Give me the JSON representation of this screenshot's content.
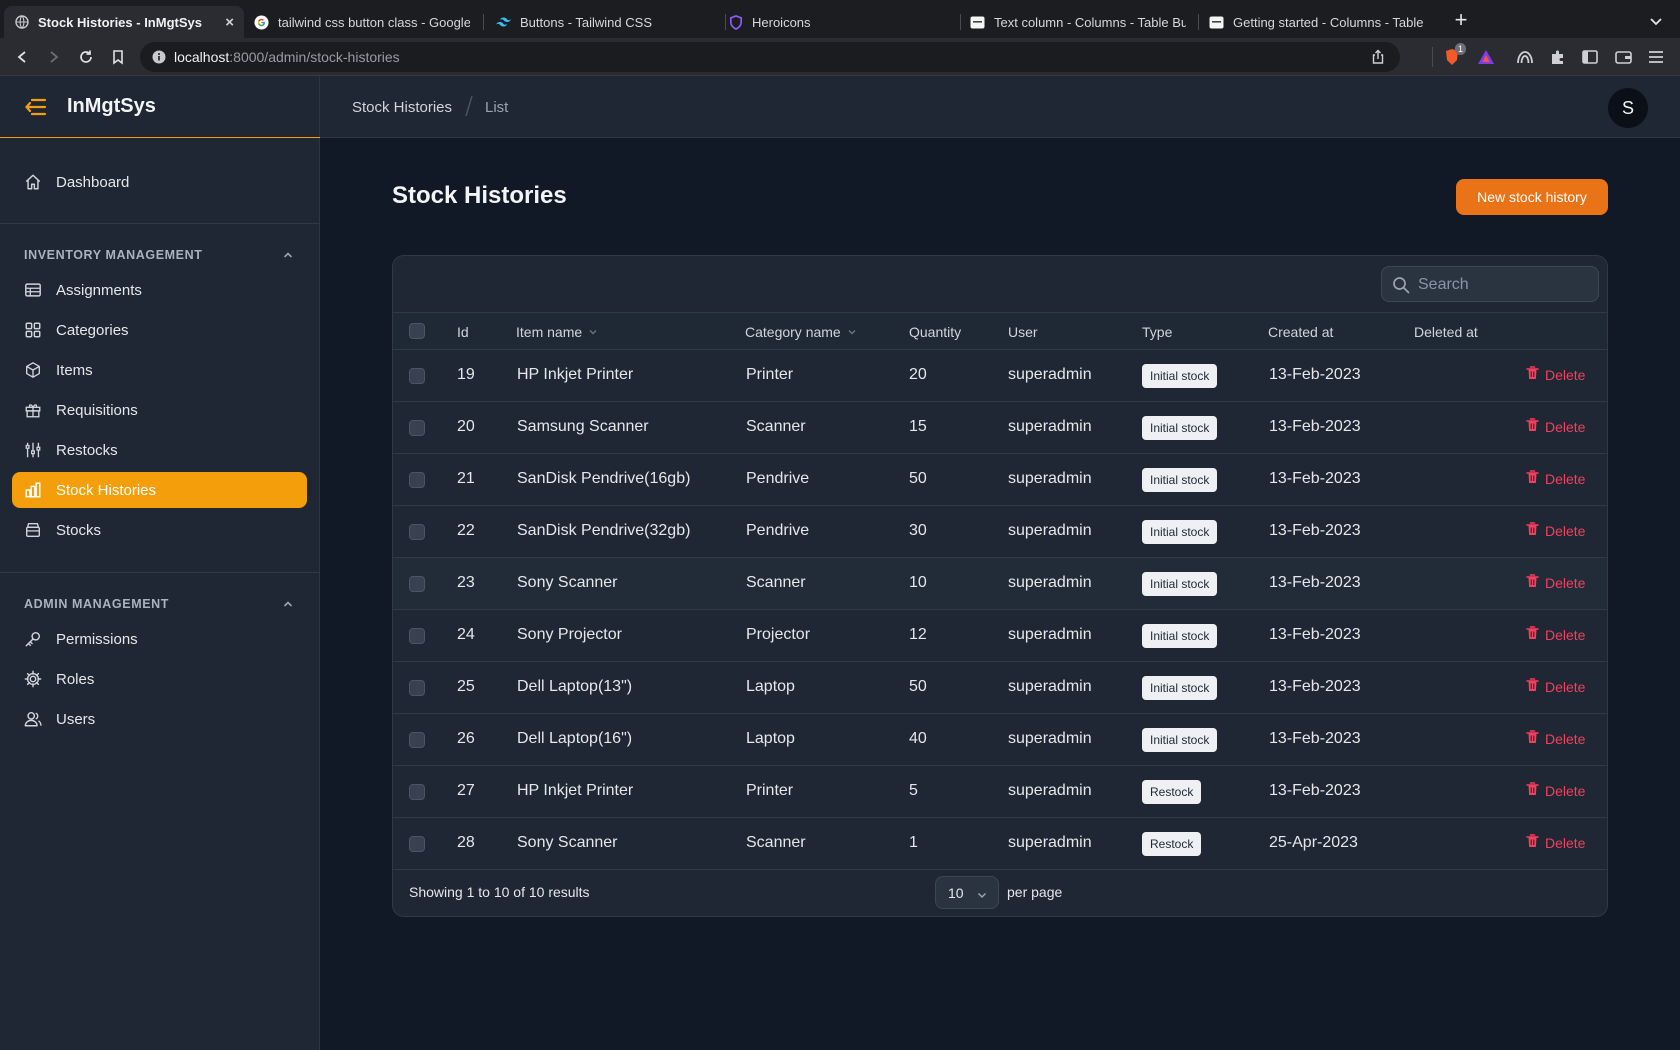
{
  "browser": {
    "tabs": [
      {
        "label": "Stock Histories - InMgtSys",
        "icon": "globe-icon",
        "active": true
      },
      {
        "label": "tailwind css button class - Google S",
        "icon": "google-icon"
      },
      {
        "label": "Buttons - Tailwind CSS",
        "icon": "tailwind-icon"
      },
      {
        "label": "Heroicons",
        "icon": "heroicons-icon"
      },
      {
        "label": "Text column - Columns - Table Build",
        "icon": "filament-icon"
      },
      {
        "label": "Getting started - Columns - Table B",
        "icon": "filament-icon"
      }
    ],
    "close_glyph": "×",
    "new_tab_glyph": "+",
    "url_host": "localhost",
    "url_path": ":8000/admin/stock-histories",
    "extension_badge": "1"
  },
  "app": {
    "brand": "InMgtSys",
    "avatar_initial": "S",
    "accent_color": "#f59e0b"
  },
  "sidebar": {
    "dashboard": {
      "label": "Dashboard",
      "icon": "home-icon"
    },
    "groups": [
      {
        "label": "INVENTORY MANAGEMENT",
        "items": [
          {
            "label": "Assignments",
            "icon": "table-icon"
          },
          {
            "label": "Categories",
            "icon": "squares-icon"
          },
          {
            "label": "Items",
            "icon": "cube-icon"
          },
          {
            "label": "Requisitions",
            "icon": "gift-icon"
          },
          {
            "label": "Restocks",
            "icon": "adjustments-icon"
          },
          {
            "label": "Stock Histories",
            "icon": "chart-bar-icon",
            "active": true
          },
          {
            "label": "Stocks",
            "icon": "archive-icon"
          }
        ]
      },
      {
        "label": "ADMIN MANAGEMENT",
        "items": [
          {
            "label": "Permissions",
            "icon": "key-icon"
          },
          {
            "label": "Roles",
            "icon": "cog-icon"
          },
          {
            "label": "Users",
            "icon": "users-icon"
          }
        ]
      }
    ]
  },
  "breadcrumb": [
    "Stock Histories",
    "List"
  ],
  "page": {
    "title": "Stock Histories",
    "new_button": "New stock history"
  },
  "table": {
    "search_placeholder": "Search",
    "columns": [
      "Id",
      "Item name",
      "Category name",
      "Quantity",
      "User",
      "Type",
      "Created at",
      "Deleted at"
    ],
    "rows": [
      {
        "id": "19",
        "item": "HP Inkjet Printer",
        "category": "Printer",
        "quantity": "20",
        "user": "superadmin",
        "type": "Initial stock",
        "created": "13-Feb-2023",
        "action": "Delete"
      },
      {
        "id": "20",
        "item": "Samsung Scanner",
        "category": "Scanner",
        "quantity": "15",
        "user": "superadmin",
        "type": "Initial stock",
        "created": "13-Feb-2023",
        "action": "Delete"
      },
      {
        "id": "21",
        "item": "SanDisk Pendrive(16gb)",
        "category": "Pendrive",
        "quantity": "50",
        "user": "superadmin",
        "type": "Initial stock",
        "created": "13-Feb-2023",
        "action": "Delete"
      },
      {
        "id": "22",
        "item": "SanDisk Pendrive(32gb)",
        "category": "Pendrive",
        "quantity": "30",
        "user": "superadmin",
        "type": "Initial stock",
        "created": "13-Feb-2023",
        "action": "Delete"
      },
      {
        "id": "23",
        "item": "Sony Scanner",
        "category": "Scanner",
        "quantity": "10",
        "user": "superadmin",
        "type": "Initial stock",
        "created": "13-Feb-2023",
        "action": "Delete"
      },
      {
        "id": "24",
        "item": "Sony Projector",
        "category": "Projector",
        "quantity": "12",
        "user": "superadmin",
        "type": "Initial stock",
        "created": "13-Feb-2023",
        "action": "Delete"
      },
      {
        "id": "25",
        "item": "Dell Laptop(13\")",
        "category": "Laptop",
        "quantity": "50",
        "user": "superadmin",
        "type": "Initial stock",
        "created": "13-Feb-2023",
        "action": "Delete"
      },
      {
        "id": "26",
        "item": "Dell Laptop(16\")",
        "category": "Laptop",
        "quantity": "40",
        "user": "superadmin",
        "type": "Initial stock",
        "created": "13-Feb-2023",
        "action": "Delete"
      },
      {
        "id": "27",
        "item": "HP Inkjet Printer",
        "category": "Printer",
        "quantity": "5",
        "user": "superadmin",
        "type": "Restock",
        "created": "13-Feb-2023",
        "action": "Delete"
      },
      {
        "id": "28",
        "item": "Sony Scanner",
        "category": "Scanner",
        "quantity": "1",
        "user": "superadmin",
        "type": "Restock",
        "created": "25-Apr-2023",
        "action": "Delete"
      }
    ],
    "footer_text": "Showing 1 to 10 of 10 results",
    "per_page_value": "10",
    "per_page_label": "per page"
  }
}
